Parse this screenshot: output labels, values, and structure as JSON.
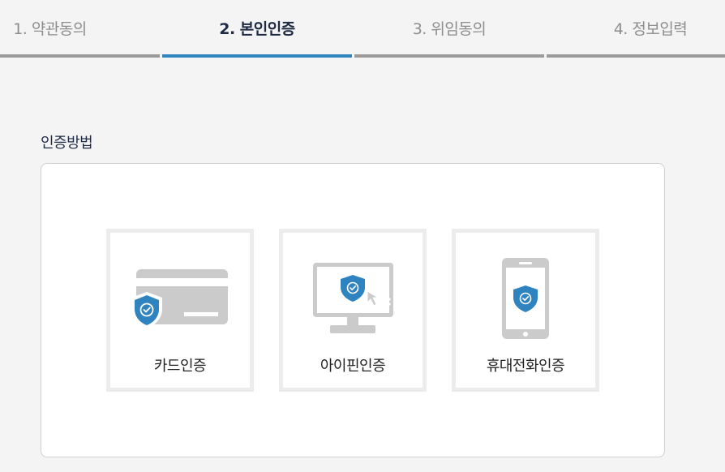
{
  "steps": [
    {
      "label": "1. 약관동의",
      "active": false
    },
    {
      "label": "2. 본인인증",
      "active": true
    },
    {
      "label": "3. 위임동의",
      "active": false
    },
    {
      "label": "4. 정보입력",
      "active": false
    }
  ],
  "section": {
    "title": "인증방법"
  },
  "options": [
    {
      "label": "카드인증",
      "icon": "card-shield-icon"
    },
    {
      "label": "아이핀인증",
      "icon": "monitor-shield-icon"
    },
    {
      "label": "휴대전화인증",
      "icon": "phone-shield-icon"
    }
  ],
  "colors": {
    "accent": "#2f84bf",
    "inactive_bar": "#9a9a9a",
    "icon_gray": "#cbcbcb",
    "shield_blue": "#2f84bf"
  }
}
